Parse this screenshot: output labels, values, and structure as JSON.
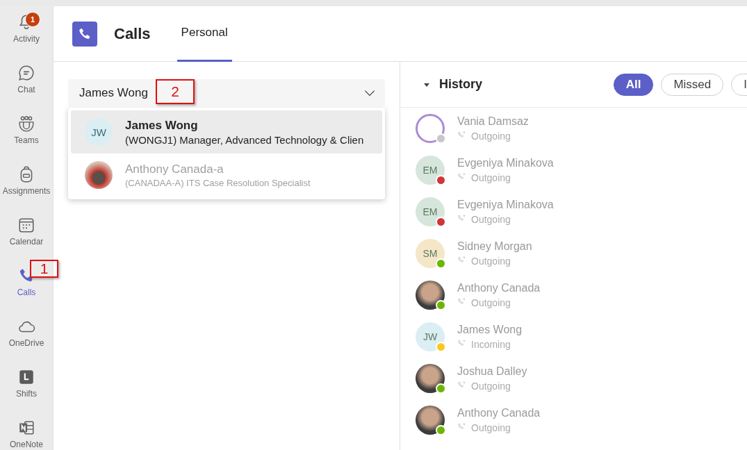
{
  "rail": {
    "items": [
      {
        "label": "Activity",
        "kind": "bell",
        "selected": false,
        "badge": "1"
      },
      {
        "label": "Chat",
        "kind": "chat",
        "selected": false
      },
      {
        "label": "Teams",
        "kind": "teams",
        "selected": false
      },
      {
        "label": "Assignments",
        "kind": "backpack",
        "selected": false
      },
      {
        "label": "Calendar",
        "kind": "calendar",
        "selected": false
      },
      {
        "label": "Calls",
        "kind": "phone",
        "selected": true
      },
      {
        "label": "OneDrive",
        "kind": "cloud",
        "selected": false
      },
      {
        "label": "Shifts",
        "kind": "clock",
        "selected": false
      },
      {
        "label": "OneNote",
        "kind": "notebook",
        "selected": false
      }
    ]
  },
  "header": {
    "title": "Calls",
    "tabs": [
      {
        "label": "Personal",
        "selected": true
      }
    ]
  },
  "picker": {
    "value": "James Wong",
    "suggestions": [
      {
        "name": "James Wong",
        "detail": "(WONGJ1) Manager, Advanced Technology & Clien",
        "kind": "initials",
        "initials": "JW",
        "selected": true
      },
      {
        "name": "Anthony Canada-a",
        "detail": "(CANADAA-A) ITS Case Resolution Specialist",
        "kind": "photo",
        "selected": false
      }
    ]
  },
  "history": {
    "title": "History",
    "expanded": true,
    "filters": [
      {
        "label": "All",
        "selected": true
      },
      {
        "label": "Missed",
        "selected": false
      },
      {
        "label": "I",
        "selected": false
      }
    ],
    "calls": [
      {
        "name": "Vania Damsaz",
        "direction": "Outgoing",
        "avatar": {
          "kind": "logo"
        },
        "status": {
          "color": "#c8c8c8"
        }
      },
      {
        "name": "Evgeniya Minakova",
        "direction": "Outgoing",
        "avatar": {
          "kind": "initials",
          "initials": "EM",
          "color": "#d6e6dc"
        },
        "status": {
          "color": "#d13438"
        }
      },
      {
        "name": "Evgeniya Minakova",
        "direction": "Outgoing",
        "avatar": {
          "kind": "initials",
          "initials": "EM",
          "color": "#d6e6dc"
        },
        "status": {
          "color": "#d13438"
        }
      },
      {
        "name": "Sidney Morgan",
        "direction": "Outgoing",
        "avatar": {
          "kind": "initials",
          "initials": "SM",
          "color": "#f5e6c8"
        },
        "status": {
          "color": "#6bb700"
        }
      },
      {
        "name": "Anthony Canada",
        "direction": "Outgoing",
        "avatar": {
          "kind": "photo"
        },
        "status": {
          "color": "#6bb700"
        }
      },
      {
        "name": "James Wong",
        "direction": "Incoming",
        "avatar": {
          "kind": "initials",
          "initials": "JW",
          "color": "#daeef3"
        },
        "status": {
          "color": "#f8c81e"
        }
      },
      {
        "name": "Joshua Dalley",
        "direction": "Outgoing",
        "avatar": {
          "kind": "photo"
        },
        "status": {
          "color": "#6bb700"
        }
      },
      {
        "name": "Anthony Canada",
        "direction": "Outgoing",
        "avatar": {
          "kind": "photo"
        },
        "status": {
          "color": "#6bb700"
        }
      }
    ]
  },
  "annotations": [
    {
      "label": "1",
      "kind": "rail"
    },
    {
      "label": "2",
      "kind": "picker"
    }
  ]
}
